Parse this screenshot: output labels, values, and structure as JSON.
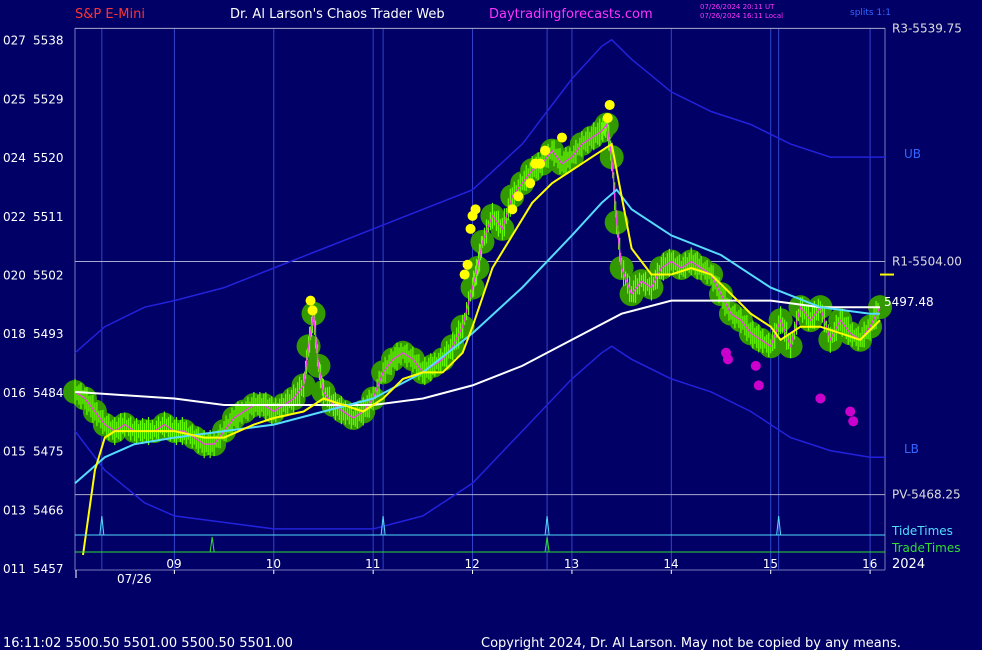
{
  "header": {
    "symbol": "S&P E-Mini",
    "site": "Dr. Al Larson's Chaos Trader Web",
    "url": "Daytradingforecasts.com",
    "stamp_ut": "07/26/2024 20:11 UT",
    "stamp_local": "07/26/2024 16:11 Local",
    "splits": "splits 1:1"
  },
  "footer": {
    "quote": "16:11:02  5500.50 5501.00 5500.50 5501.00",
    "copyright": "Copyright 2024, Dr. Al Larson. May not be copied by any means."
  },
  "colors": {
    "background": "#000066",
    "grid": "#7777bb",
    "price": "#66ff00",
    "ema_yellow": "#ffff00",
    "ema_cyan": "#55ddff",
    "ma_white": "#ffffff",
    "band": "#2222dd",
    "fast_magenta": "#ff33ff",
    "tide": "#55ddff",
    "trade": "#33dd33",
    "title_red": "#ff3333",
    "title_magenta": "#ff33ff"
  },
  "chart_data": {
    "type": "line",
    "date_label": "07/26",
    "year_label": "2024",
    "x_hours": [
      "09",
      "10",
      "11",
      "12",
      "13",
      "14",
      "15",
      "16"
    ],
    "xlim": [
      8.0,
      16.15
    ],
    "y_ticks": [
      {
        "left": "011",
        "price": 5457
      },
      {
        "left": "013",
        "price": 5466
      },
      {
        "left": "015",
        "price": 5475
      },
      {
        "left": "016",
        "price": 5484
      },
      {
        "left": "018",
        "price": 5493
      },
      {
        "left": "020",
        "price": 5502
      },
      {
        "left": "022",
        "price": 5511
      },
      {
        "left": "024",
        "price": 5520
      },
      {
        "left": "025",
        "price": 5529
      },
      {
        "left": "027",
        "price": 5538
      }
    ],
    "ylim": [
      5456.7,
      5539.8
    ],
    "levels": [
      {
        "label": "R3-5539.75",
        "value": 5539.75
      },
      {
        "label": "R1-5504.00",
        "value": 5504.0
      },
      {
        "label": "PV-5468.25",
        "value": 5468.25
      }
    ],
    "band_labels": [
      {
        "label": "UB",
        "x": 16.15,
        "y": 5520.0
      },
      {
        "label": "LB",
        "x": 16.15,
        "y": 5475.0
      }
    ],
    "last_price_label": "5497.48",
    "marker_labels": [
      "TideTimes",
      "TradeTimes"
    ],
    "tide_times": [
      8.27,
      11.1,
      12.75,
      15.08
    ],
    "trade_times": [
      9.38,
      12.75
    ],
    "price": {
      "x": [
        8.0,
        8.1,
        8.2,
        8.3,
        8.4,
        8.5,
        8.6,
        8.7,
        8.8,
        8.9,
        9.0,
        9.1,
        9.2,
        9.3,
        9.4,
        9.5,
        9.6,
        9.7,
        9.8,
        9.9,
        10.0,
        10.1,
        10.2,
        10.3,
        10.35,
        10.4,
        10.45,
        10.5,
        10.6,
        10.7,
        10.8,
        10.9,
        11.0,
        11.1,
        11.2,
        11.3,
        11.4,
        11.5,
        11.6,
        11.7,
        11.8,
        11.9,
        12.0,
        12.05,
        12.1,
        12.2,
        12.3,
        12.4,
        12.5,
        12.6,
        12.7,
        12.8,
        12.9,
        13.0,
        13.1,
        13.2,
        13.3,
        13.35,
        13.4,
        13.45,
        13.5,
        13.6,
        13.7,
        13.8,
        13.9,
        14.0,
        14.1,
        14.2,
        14.3,
        14.4,
        14.5,
        14.6,
        14.7,
        14.8,
        14.9,
        15.0,
        15.1,
        15.2,
        15.3,
        15.4,
        15.5,
        15.6,
        15.7,
        15.8,
        15.9,
        16.0,
        16.1
      ],
      "y": [
        5484,
        5483,
        5481,
        5479,
        5478,
        5479,
        5478,
        5478,
        5478,
        5479,
        5478,
        5478,
        5477,
        5476,
        5476,
        5478,
        5480,
        5481,
        5482,
        5482,
        5481,
        5482,
        5483,
        5485,
        5491,
        5496,
        5488,
        5484,
        5482,
        5481,
        5480,
        5481,
        5483,
        5487,
        5489,
        5490,
        5489,
        5487,
        5488,
        5489,
        5491,
        5494,
        5500,
        5503,
        5507,
        5511,
        5509,
        5514,
        5516,
        5518,
        5519,
        5521,
        5519,
        5520,
        5522,
        5523,
        5524,
        5525,
        5520,
        5510,
        5503,
        5499,
        5501,
        5500,
        5503,
        5504,
        5503,
        5504,
        5503,
        5502,
        5499,
        5496,
        5495,
        5493,
        5492,
        5491,
        5495,
        5491,
        5497,
        5495,
        5497,
        5492,
        5495,
        5493,
        5492,
        5494,
        5497
      ]
    },
    "ema_yellow": {
      "x": [
        8.08,
        8.2,
        8.3,
        8.4,
        8.5,
        8.7,
        9.0,
        9.3,
        9.5,
        9.8,
        10.0,
        10.3,
        10.5,
        10.7,
        10.9,
        11.1,
        11.3,
        11.5,
        11.7,
        11.9,
        12.0,
        12.2,
        12.4,
        12.6,
        12.8,
        13.0,
        13.2,
        13.4,
        13.5,
        13.6,
        13.8,
        14.0,
        14.2,
        14.4,
        14.6,
        14.8,
        15.0,
        15.1,
        15.3,
        15.5,
        15.7,
        15.9,
        16.1
      ],
      "y": [
        5459,
        5472,
        5477,
        5478,
        5478,
        5478,
        5478,
        5477,
        5477,
        5479,
        5480,
        5481,
        5483,
        5482,
        5481,
        5483,
        5486,
        5487,
        5487,
        5490,
        5494,
        5503,
        5508,
        5513,
        5516,
        5518,
        5520,
        5522,
        5514,
        5506,
        5502,
        5502,
        5503,
        5502,
        5499,
        5496,
        5494,
        5492,
        5494,
        5494,
        5493,
        5492,
        5495
      ]
    },
    "ema_cyan": {
      "x": [
        8.0,
        8.3,
        8.6,
        9.0,
        9.5,
        10.0,
        10.5,
        11.0,
        11.5,
        12.0,
        12.5,
        13.0,
        13.3,
        13.45,
        13.6,
        14.0,
        14.5,
        15.0,
        15.5,
        16.0,
        16.1
      ],
      "y": [
        5470,
        5474,
        5476,
        5477,
        5478,
        5479,
        5481,
        5483,
        5487,
        5493,
        5500,
        5508,
        5513,
        5515,
        5512,
        5508,
        5505,
        5500,
        5497,
        5496,
        5496
      ]
    },
    "ma_white": {
      "x": [
        8.0,
        8.5,
        9.0,
        9.5,
        10.0,
        10.5,
        11.0,
        11.5,
        12.0,
        12.5,
        13.0,
        13.5,
        14.0,
        14.5,
        15.0,
        15.5,
        16.0,
        16.1
      ],
      "y": [
        5484,
        5483.5,
        5483,
        5482,
        5482,
        5482,
        5482,
        5483,
        5485,
        5488,
        5492,
        5496,
        5498,
        5498,
        5498,
        5497,
        5497,
        5497
      ]
    },
    "upper_band": {
      "x": [
        8.0,
        8.3,
        8.7,
        9.0,
        9.5,
        10.0,
        10.5,
        11.0,
        11.5,
        12.0,
        12.5,
        13.0,
        13.3,
        13.4,
        13.6,
        14.0,
        14.4,
        14.8,
        15.2,
        15.6,
        16.0,
        16.15
      ],
      "y": [
        5490,
        5494,
        5497,
        5498,
        5500,
        5503,
        5506,
        5509,
        5512,
        5515,
        5522,
        5532,
        5537,
        5538,
        5535,
        5530,
        5527,
        5525,
        5522,
        5520,
        5520,
        5520
      ]
    },
    "lower_band": {
      "x": [
        8.0,
        8.3,
        8.7,
        9.0,
        9.5,
        10.0,
        10.5,
        11.0,
        11.5,
        12.0,
        12.5,
        13.0,
        13.3,
        13.4,
        13.6,
        14.0,
        14.4,
        14.8,
        15.2,
        15.6,
        16.0,
        16.15
      ],
      "y": [
        5478,
        5472,
        5467,
        5465,
        5464,
        5463,
        5463,
        5463,
        5465,
        5470,
        5478,
        5486,
        5490,
        5491,
        5489,
        5486,
        5484,
        5481,
        5477,
        5475,
        5474,
        5474
      ]
    },
    "yellow_dots": {
      "x": [
        10.37,
        10.39,
        11.92,
        11.95,
        11.98,
        12.0,
        12.03,
        12.4,
        12.46,
        12.58,
        12.63,
        12.68,
        12.73,
        12.9,
        13.36,
        13.38
      ],
      "y": [
        5498,
        5496.5,
        5502,
        5503.5,
        5509,
        5511,
        5512,
        5512,
        5514,
        5516,
        5519,
        5519,
        5521,
        5523,
        5526,
        5528
      ]
    },
    "magenta_dots": {
      "x": [
        14.55,
        14.57,
        14.85,
        14.88,
        15.5,
        15.8,
        15.83
      ],
      "y": [
        5490,
        5489,
        5488,
        5485,
        5483,
        5481,
        5479.5
      ]
    }
  }
}
